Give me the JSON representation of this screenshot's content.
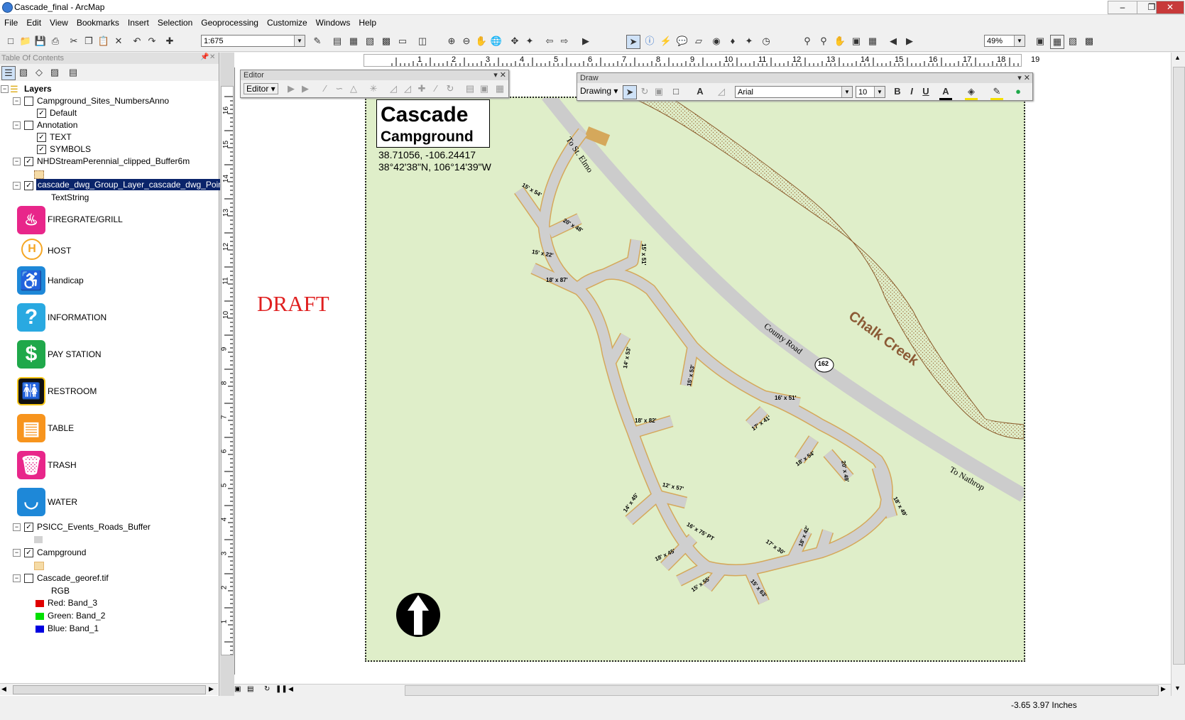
{
  "window": {
    "title": "Cascade_final - ArcMap",
    "min": "–",
    "max": "❐",
    "close": "✕"
  },
  "menu": [
    "File",
    "Edit",
    "View",
    "Bookmarks",
    "Insert",
    "Selection",
    "Geoprocessing",
    "Customize",
    "Windows",
    "Help"
  ],
  "toolbar": {
    "scale": "1:675",
    "zoom": "49%"
  },
  "toc": {
    "header": "Table Of Contents",
    "root": "Layers",
    "layers": [
      {
        "name": "Campground_Sites_NumbersAnno",
        "checked": false,
        "children": [
          {
            "name": "Default",
            "checked": true
          }
        ]
      },
      {
        "name": "Annotation",
        "checked": false,
        "children": [
          {
            "name": "TEXT",
            "checked": true
          },
          {
            "name": "SYMBOLS",
            "checked": true
          }
        ]
      },
      {
        "name": "NHDStreamPerennial_clipped_Buffer6m",
        "checked": true
      },
      {
        "name": "cascade_dwg_Group_Layer_cascade_dwg_Point",
        "checked": true,
        "selected": true,
        "field": "TextString"
      }
    ],
    "symbols": [
      {
        "label": "FIREGRATE/GRILL",
        "icon": "fire-icon",
        "color": "#e8268a"
      },
      {
        "label": "HOST",
        "icon": "host-icon",
        "color": "#f5a623"
      },
      {
        "label": "Handicap",
        "icon": "handicap-icon",
        "color": "#1e88d8"
      },
      {
        "label": "INFORMATION",
        "icon": "information-icon",
        "color": "#29a9e1"
      },
      {
        "label": "PAY STATION",
        "icon": "dollar-icon",
        "color": "#1fa84a"
      },
      {
        "label": "RESTROOM",
        "icon": "restroom-icon",
        "color": "#111111"
      },
      {
        "label": "TABLE",
        "icon": "table-icon",
        "color": "#f7941d"
      },
      {
        "label": "TRASH",
        "icon": "trash-icon",
        "color": "#e8268a"
      },
      {
        "label": "WATER",
        "icon": "water-icon",
        "color": "#1e88d8"
      }
    ],
    "more_layers": [
      {
        "name": "PSICC_Events_Roads_Buffer",
        "checked": true,
        "swatch": "#d2d2d2"
      },
      {
        "name": "Campground",
        "checked": true,
        "swatch": "#f5dba6"
      },
      {
        "name": "Cascade_georef.tif",
        "checked": false
      }
    ],
    "rgb": {
      "label": "RGB",
      "red": "Red:    Band_3",
      "green": "Green: Band_2",
      "blue": "Blue:   Band_1"
    }
  },
  "editor": {
    "title": "Editor",
    "menu": "Editor ▾"
  },
  "draw": {
    "title": "Draw",
    "menu": "Drawing ▾",
    "font": "Arial",
    "size": "10",
    "bold": "B",
    "italic": "I",
    "underline": "U"
  },
  "map": {
    "title_line1": "Cascade",
    "title_line2": "Campground",
    "coords_decimal": "38.71056, -106.24417",
    "coords_dms": "38°42'38\"N, 106°14'39\"W",
    "draft": "DRAFT",
    "road_to_st_elmo": "To St. Elmo",
    "road_county": "County Road",
    "road_number": "162",
    "road_to_nathrop": "To Nathrop",
    "creek": "Chalk Creek",
    "sites": [
      "15' x 54'",
      "20' x 48'",
      "15' x 22'",
      "18' x 87'",
      "15' x 51'",
      "14' x 53'",
      "15' x 53'",
      "18' x 82'",
      "16' x 51'",
      "17' x 41'",
      "18' x 54'",
      "20' x 49'",
      "18' x 49'",
      "14' x 45'",
      "12' x 57'",
      "16' x 75' PT",
      "18' x 45'",
      "17' x 30'",
      "18' x 42'",
      "15' x 55'",
      "15' x 63'"
    ]
  },
  "ruler_h": [
    "1",
    "2",
    "3",
    "4",
    "5",
    "6",
    "7",
    "8",
    "9",
    "10",
    "11",
    "12",
    "13",
    "14",
    "15",
    "16",
    "17",
    "18",
    "19"
  ],
  "ruler_v": [
    "16",
    "15",
    "14",
    "13",
    "12",
    "11",
    "10",
    "9",
    "8",
    "7",
    "6",
    "5",
    "4",
    "3",
    "2",
    "1"
  ],
  "status": "-3.65  3.97 Inches"
}
